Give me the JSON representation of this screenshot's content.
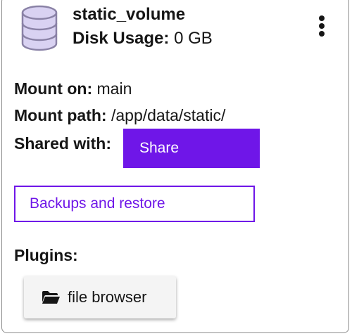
{
  "volume": {
    "name": "static_volume",
    "disk_usage_label": "Disk Usage:",
    "disk_usage_value": "0 GB"
  },
  "details": {
    "mount_on_label": "Mount on:",
    "mount_on_value": "main",
    "mount_path_label": "Mount path:",
    "mount_path_value": "/app/data/static/",
    "shared_with_label": "Shared with:"
  },
  "actions": {
    "share_label": "Share",
    "backups_label": "Backups and restore"
  },
  "plugins": {
    "label": "Plugins:",
    "items": [
      {
        "label": "file browser",
        "icon": "folder-icon"
      }
    ]
  },
  "icons": {
    "volume": "database-icon",
    "menu": "kebab-menu-icon"
  },
  "colors": {
    "accent": "#6f16e8",
    "db_icon_fill": "#d9d2f2",
    "db_icon_stroke": "#8a82a6"
  }
}
